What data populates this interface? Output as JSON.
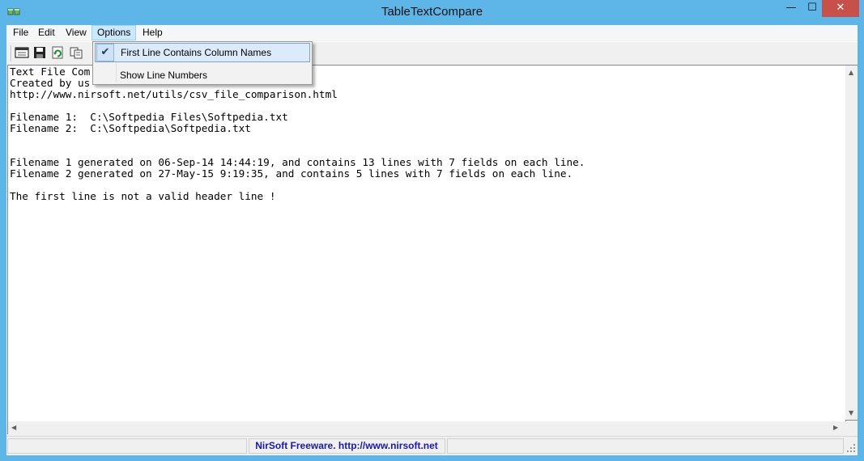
{
  "window": {
    "title": "TableTextCompare"
  },
  "title_buttons": {
    "minimize": "—",
    "maximize": "☐",
    "close": "✕"
  },
  "menu": {
    "items": [
      {
        "label": "File"
      },
      {
        "label": "Edit"
      },
      {
        "label": "View"
      },
      {
        "label": "Options"
      },
      {
        "label": "Help"
      }
    ]
  },
  "toolbar": {
    "icons": [
      "report-icon",
      "save-icon",
      "refresh-icon",
      "copy-icon"
    ]
  },
  "options_menu": {
    "items": [
      {
        "label": "First Line Contains Column Names",
        "checked": true
      },
      {
        "label": "Show Line Numbers",
        "checked": false
      }
    ]
  },
  "report": {
    "lines": [
      "Text File Com",
      "Created by us",
      "http://www.nirsoft.net/utils/csv_file_comparison.html",
      "",
      "Filename 1:  C:\\Softpedia Files\\Softpedia.txt",
      "Filename 2:  C:\\Softpedia\\Softpedia.txt",
      "",
      "",
      "Filename 1 generated on 06-Sep-14 14:44:19, and contains 13 lines with 7 fields on each line.",
      "Filename 2 generated on 27-May-15 9:19:35, and contains 5 lines with 7 fields on each line.",
      "",
      "The first line is not a valid header line !"
    ]
  },
  "status": {
    "link_text": "NirSoft Freeware.  http://www.nirsoft.net"
  }
}
